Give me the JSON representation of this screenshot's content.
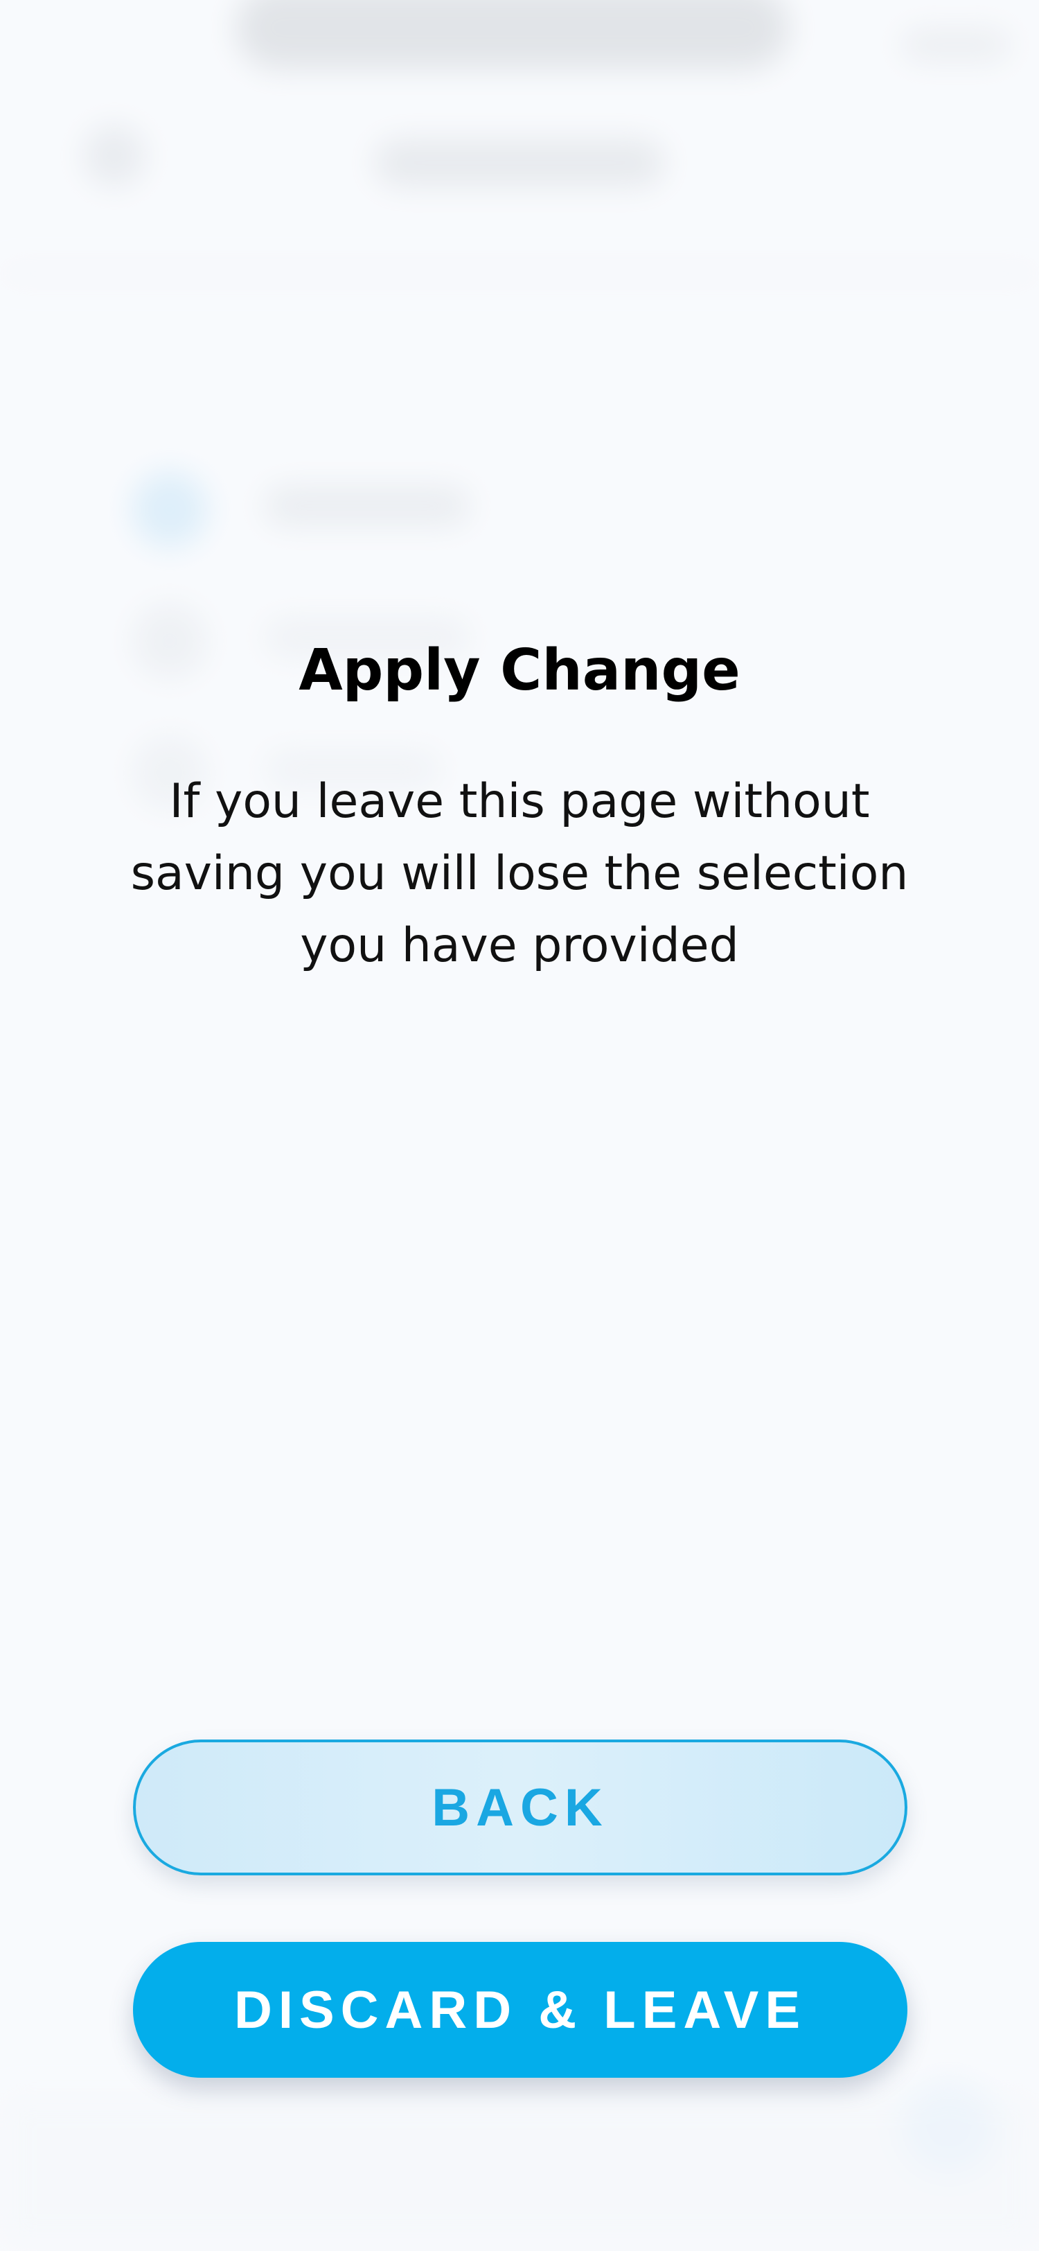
{
  "dialog": {
    "title": "Apply Change",
    "message": "If you leave this page without saving you will lose the selection you have provided",
    "back_label": "BACK",
    "discard_label": "DISCARD & LEAVE"
  },
  "colors": {
    "accent": "#03aeeb",
    "back_button_fill": "#d3ecfa",
    "back_button_border": "#1aa9e0",
    "title_text": "#000000"
  }
}
